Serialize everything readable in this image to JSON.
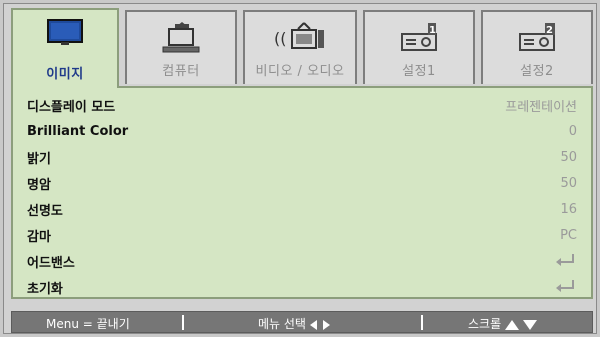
{
  "tabs": [
    {
      "label": "이미지",
      "icon": "monitor-icon",
      "active": true
    },
    {
      "label": "컴퓨터",
      "icon": "computer-icon",
      "active": false
    },
    {
      "label": "비디오 / 오디오",
      "icon": "tv-audio-icon",
      "active": false
    },
    {
      "label": "설정1",
      "icon": "projector-setting1-icon",
      "active": false
    },
    {
      "label": "설정2",
      "icon": "projector-setting2-icon",
      "active": false
    }
  ],
  "settings": [
    {
      "name": "디스플레이 모드",
      "value": "프레젠테이션"
    },
    {
      "name": "Brilliant Color",
      "value": "0"
    },
    {
      "name": "밝기",
      "value": "50"
    },
    {
      "name": "명암",
      "value": "50"
    },
    {
      "name": "선명도",
      "value": "16"
    },
    {
      "name": "감마",
      "value": "PC"
    },
    {
      "name": "어드밴스",
      "value_icon": "enter-icon"
    },
    {
      "name": "초기화",
      "value_icon": "enter-icon"
    }
  ],
  "footer": {
    "menu": "Menu = 끝내기",
    "select": "메뉴 선택",
    "scroll": "스크롤"
  },
  "colors": {
    "active_panel": "#d5e6c4",
    "active_tab_text": "#1f3a8a",
    "footer": "#767676"
  }
}
